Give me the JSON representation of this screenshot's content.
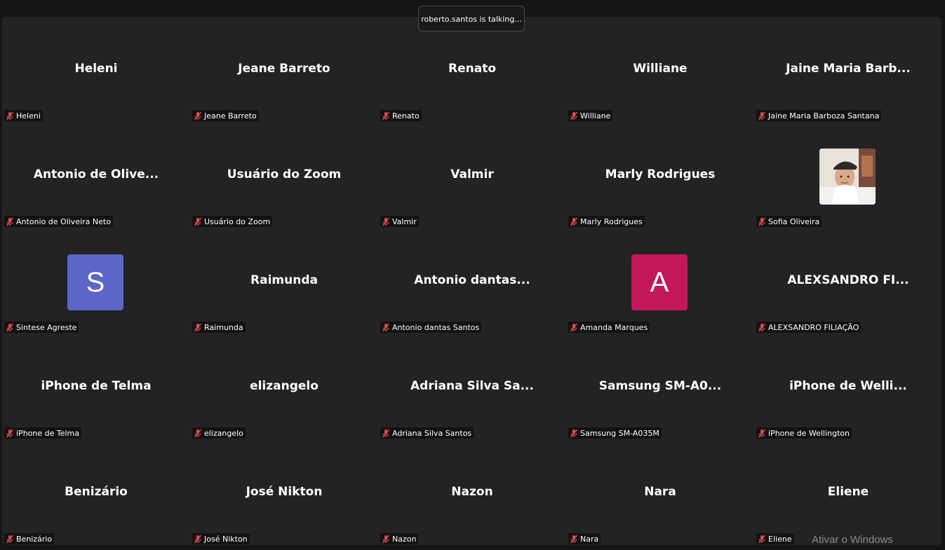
{
  "talking_indicator": "roberto.santos is talking...",
  "watermark": "Ativar o Windows",
  "colors": {
    "background": "#151515",
    "gallery": "#232323",
    "muted_mic": "#e0494b",
    "avatar_s": "#5b66c6",
    "avatar_a": "#c2185b"
  },
  "tiles": [
    {
      "display_name": "Heleni",
      "label": "Heleni"
    },
    {
      "display_name": "Jeane Barreto",
      "label": "Jeane Barreto"
    },
    {
      "display_name": "Renato",
      "label": "Renato"
    },
    {
      "display_name": "Williane",
      "label": "Williane"
    },
    {
      "display_name": "Jaine Maria Barb...",
      "label": "Jaine Maria Barboza Santana"
    },
    {
      "display_name": "Antonio de Olive...",
      "label": "Antonio de Oliveira Neto"
    },
    {
      "display_name": "Usuário do Zoom",
      "label": "Usuário do Zoom"
    },
    {
      "display_name": "Valmir",
      "label": "Valmir"
    },
    {
      "display_name": "Marly Rodrigues",
      "label": "Marly Rodrigues"
    },
    {
      "display_name": "",
      "label": "Sofia Oliveira",
      "avatar": "photo"
    },
    {
      "display_name": "",
      "label": "Sintese Agreste",
      "avatar": "letter",
      "letter": "S"
    },
    {
      "display_name": "Raimunda",
      "label": "Raimunda"
    },
    {
      "display_name": "Antonio dantas...",
      "label": "Antonio dantas Santos"
    },
    {
      "display_name": "",
      "label": "Amanda Marques",
      "avatar": "letter",
      "letter": "A"
    },
    {
      "display_name": "ALEXSANDRO FI...",
      "label": "ALEXSANDRO FILIAÇÃO"
    },
    {
      "display_name": "iPhone de Telma",
      "label": "iPhone de Telma"
    },
    {
      "display_name": "elizangelo",
      "label": "elizangelo"
    },
    {
      "display_name": "Adriana Silva Sa...",
      "label": "Adriana Silva Santos"
    },
    {
      "display_name": "Samsung SM-A0...",
      "label": "Samsung SM-A035M"
    },
    {
      "display_name": "iPhone de Welli...",
      "label": "iPhone de Wellington"
    },
    {
      "display_name": "Benizário",
      "label": "Benizário"
    },
    {
      "display_name": "José Nikton",
      "label": "José Nikton"
    },
    {
      "display_name": "Nazon",
      "label": "Nazon"
    },
    {
      "display_name": "Nara",
      "label": "Nara"
    },
    {
      "display_name": "Eliene",
      "label": "Eliene"
    }
  ]
}
